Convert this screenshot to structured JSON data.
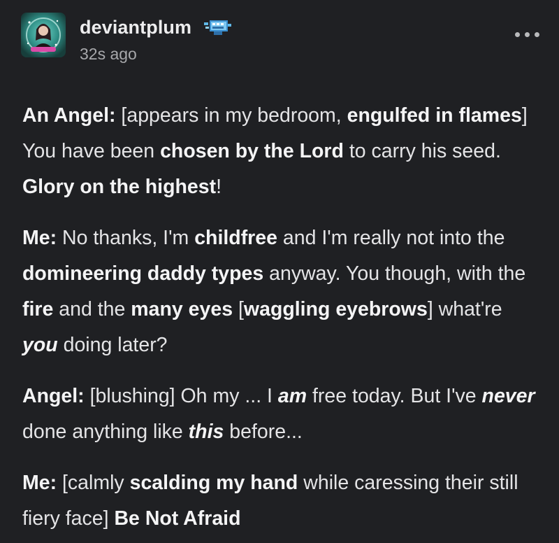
{
  "post": {
    "username": "deviantplum",
    "timestamp": "32s ago",
    "more_icon": "ellipsis-icon",
    "badge_icon": "pixel-badge-icon",
    "avatar_icon": "user-avatar-icon"
  },
  "body": {
    "p1": {
      "speaker": "An Angel:",
      "t1": " [appears in my bedroom, ",
      "b1": "engulfed in flames",
      "t2": "] You have been ",
      "b2": "chosen by the Lord",
      "t3": " to carry his seed. ",
      "b3": "Glory on the highest",
      "t4": "!"
    },
    "p2": {
      "speaker": "Me:",
      "t1": " No thanks, I'm ",
      "b1": "childfree",
      "t2": " and I'm really not into the ",
      "b2": "domineering daddy types",
      "t3": " anyway. You though, with the ",
      "b3": "fire",
      "t4": " and the ",
      "b4": "many eyes",
      "t5": " [",
      "b5": "waggling eyebrows",
      "t6": "] what're ",
      "bi1": "you",
      "t7": " doing later?"
    },
    "p3": {
      "speaker": "Angel:",
      "t1": " [blushing] Oh my ... I ",
      "bi1": "am",
      "t2": " free today. But I've ",
      "bi2": "never",
      "t3": " done anything like ",
      "bi3": "this",
      "t4": " before..."
    },
    "p4": {
      "speaker": "Me:",
      "t1": " [calmly ",
      "b1": "scalding my hand",
      "t2": " while caressing their still fiery face] ",
      "b2": "Be Not Afraid"
    }
  },
  "colors": {
    "background": "#1f2023",
    "text": "#e4e4e6",
    "muted": "#a7a8ab"
  }
}
